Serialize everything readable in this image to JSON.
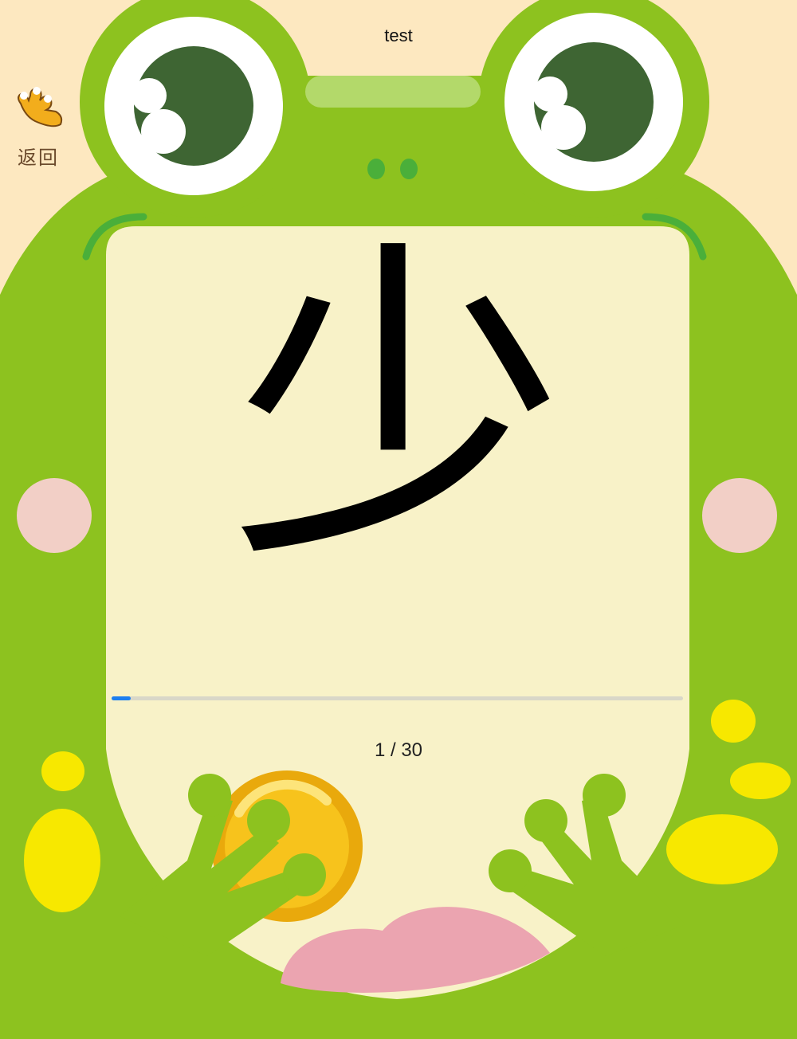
{
  "header": {
    "title": "test"
  },
  "back": {
    "label": "返回",
    "icon": "frog-hand-icon"
  },
  "card": {
    "character": "少"
  },
  "progress": {
    "current": "1",
    "separator": " / ",
    "total": "30",
    "fraction": 0.0333
  },
  "colors": {
    "background": "#fde8c0",
    "frog_green": "#8dc21f",
    "card": "#f8f2c8",
    "eye_pupil": "#3e6533",
    "cheek": "#f2cfc6",
    "tongue": "#eba4b0",
    "spots": "#f7e800",
    "progress": "#1d7ff0"
  }
}
